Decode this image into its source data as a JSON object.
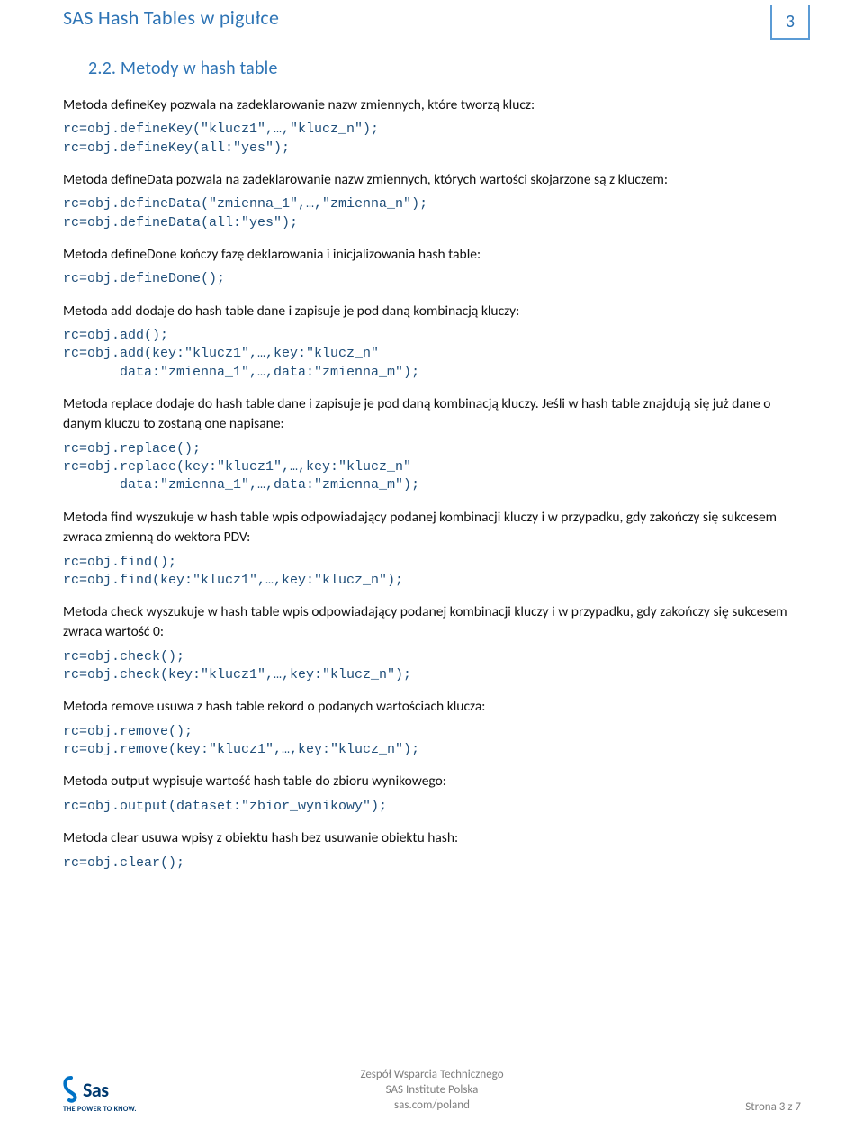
{
  "header": {
    "title": "SAS Hash Tables w pigułce",
    "page_number": "3"
  },
  "section_heading": "2.2. Metody w hash table",
  "blocks": [
    {
      "para": "Metoda defineKey pozwala na zadeklarowanie nazw zmiennych, które tworzą klucz:",
      "code": "rc=obj.defineKey(\"klucz1\",…,\"klucz_n\");\nrc=obj.defineKey(all:\"yes\");"
    },
    {
      "para": "Metoda defineData  pozwala na zadeklarowanie nazw zmiennych, których wartości skojarzone są z kluczem:",
      "code": "rc=obj.defineData(\"zmienna_1\",…,\"zmienna_n\");\nrc=obj.defineData(all:\"yes\");"
    },
    {
      "para": "Metoda defineDone kończy fazę deklarowania i inicjalizowania hash table:",
      "code": "rc=obj.defineDone();"
    },
    {
      "para": "Metoda add dodaje do hash table dane i zapisuje je pod daną kombinacją kluczy:",
      "code": "rc=obj.add();\nrc=obj.add(key:\"klucz1\",…,key:\"klucz_n\"\n       data:\"zmienna_1\",…,data:\"zmienna_m\");"
    },
    {
      "para": "Metoda replace dodaje do hash table dane i zapisuje je pod daną kombinacją kluczy. Jeśli w hash table znajdują się już dane o danym kluczu to zostaną one napisane:",
      "code": "rc=obj.replace();\nrc=obj.replace(key:\"klucz1\",…,key:\"klucz_n\"\n       data:\"zmienna_1\",…,data:\"zmienna_m\");"
    },
    {
      "para": "Metoda find wyszukuje w hash table wpis odpowiadający podanej kombinacji kluczy i w przypadku, gdy zakończy się sukcesem zwraca zmienną do wektora PDV:",
      "code": "rc=obj.find();\nrc=obj.find(key:\"klucz1\",…,key:\"klucz_n\");"
    },
    {
      "para": "Metoda check wyszukuje w hash table wpis odpowiadający podanej kombinacji kluczy i w przypadku, gdy zakończy się sukcesem zwraca wartość 0:",
      "code": "rc=obj.check();\nrc=obj.check(key:\"klucz1\",…,key:\"klucz_n\");"
    },
    {
      "para": "Metoda remove usuwa z hash table rekord o podanych wartościach klucza:",
      "code": "rc=obj.remove();\nrc=obj.remove(key:\"klucz1\",…,key:\"klucz_n\");"
    },
    {
      "para": "Metoda output wypisuje wartość hash table do zbioru wynikowego:",
      "code": "rc=obj.output(dataset:\"zbior_wynikowy\");"
    },
    {
      "para": "Metoda clear usuwa wpisy z obiektu hash bez usuwanie obiektu hash:",
      "code": "rc=obj.clear();"
    }
  ],
  "footer": {
    "center_line1": "Zespół Wsparcia Technicznego",
    "center_line2": "SAS Institute Polska",
    "center_line3": "sas.com/poland",
    "right": "Strona 3 z 7",
    "logo_text": "Sas",
    "logo_sub": "THE POWER TO KNOW."
  }
}
